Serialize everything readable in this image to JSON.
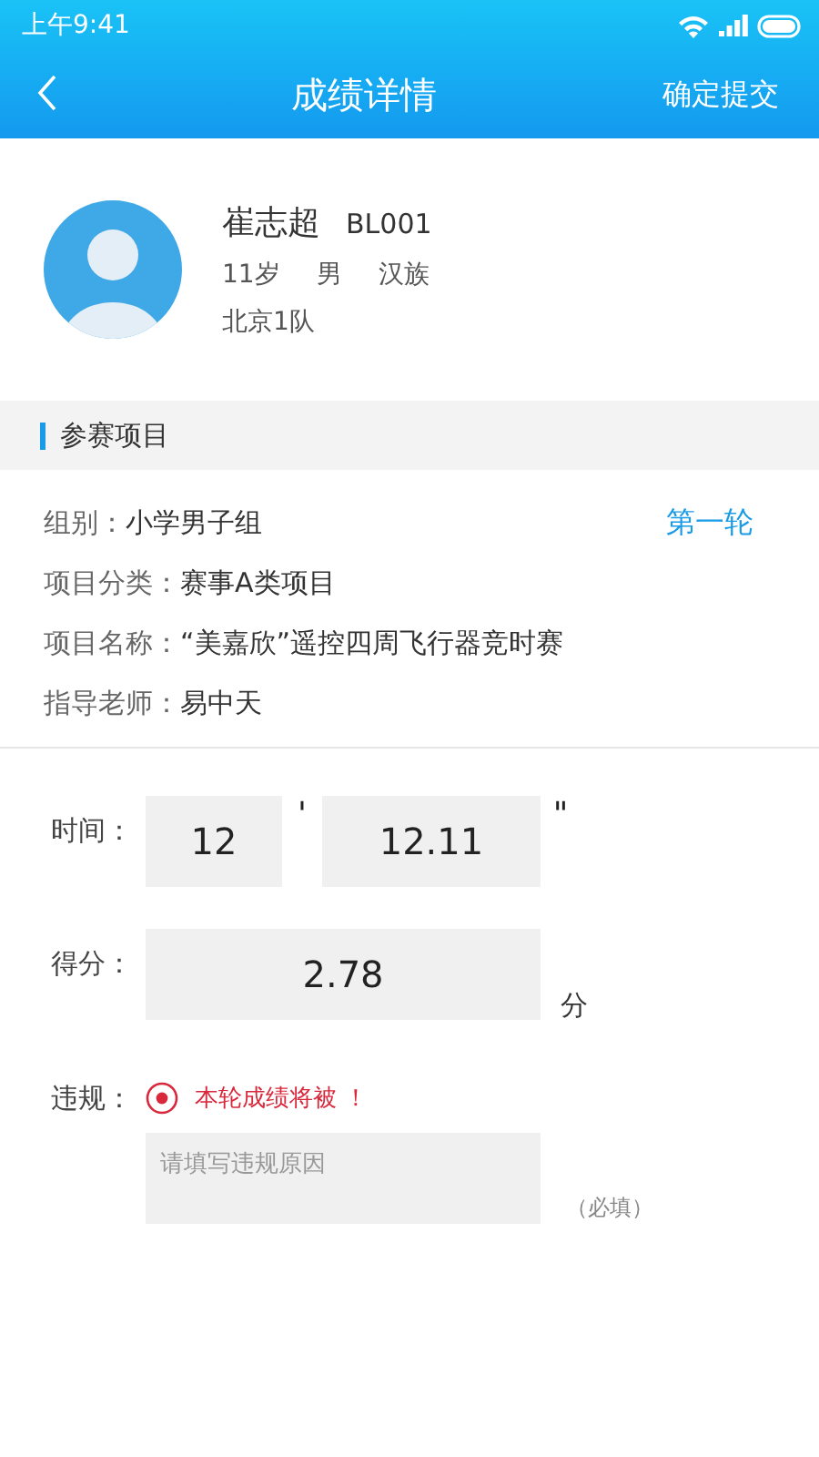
{
  "status_bar": {
    "time": "上午9:41"
  },
  "nav": {
    "title": "成绩详情",
    "action": "确定提交"
  },
  "athlete": {
    "name": "崔志超",
    "id": "BL001",
    "age": "11岁",
    "gender": "男",
    "ethnicity": "汉族",
    "team": "北京1队"
  },
  "section": {
    "title": "参赛项目"
  },
  "round": "第一轮",
  "details": [
    {
      "label": "组别：",
      "value": "小学男子组"
    },
    {
      "label": "项目分类：",
      "value": "赛事A类项目"
    },
    {
      "label": "项目名称：",
      "value": "“美嘉欣”遥控四周飞行器竞时赛"
    },
    {
      "label": "指导老师：",
      "value": "易中天"
    }
  ],
  "time": {
    "label": "时间：",
    "minutes": "12",
    "minute_mark": "'",
    "seconds": "12.11",
    "second_mark": "\""
  },
  "score": {
    "label": "得分：",
    "value": "2.78",
    "unit": "分"
  },
  "violation": {
    "label": "违规：",
    "checked": true,
    "message": "本轮成绩将被 ！",
    "placeholder": "请填写违规原因",
    "required_note": "（必填）"
  }
}
